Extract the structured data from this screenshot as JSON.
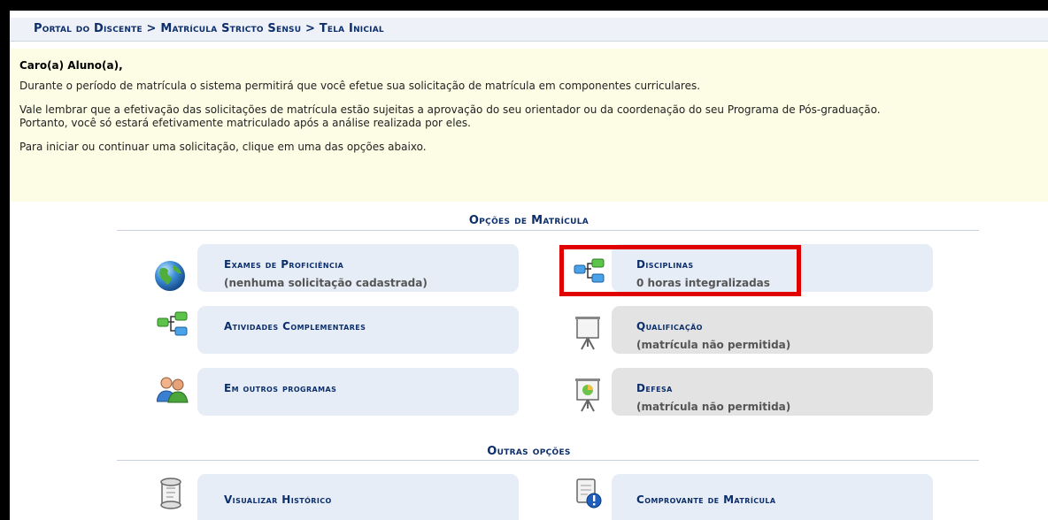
{
  "breadcrumb": "Portal do Discente > Matrícula Stricto Sensu > Tela Inicial",
  "notice": {
    "greeting": "Caro(a) Aluno(a),",
    "line1": "Durante o período de matrícula o sistema permitirá que você efetue sua solicitação de matrícula em componentes curriculares.",
    "line2a": "Vale lembrar que a efetivação das solicitações de matrícula estão sujeitas a aprovação do seu orientador ou da coordenação do seu Programa de Pós-graduação.",
    "line2b": "Portanto, você só estará efetivamente matriculado após a análise realizada por eles.",
    "line3": "Para iniciar ou continuar uma solicitação, clique em uma das opções abaixo."
  },
  "sections": {
    "opcoes": "Opções de Matrícula",
    "outras": "Outras opções"
  },
  "options": {
    "exames": {
      "title": "Exames de Proficiência",
      "sub": "(nenhuma solicitação cadastrada)",
      "icon": "globe-icon"
    },
    "disciplinas": {
      "title": "Disciplinas",
      "sub": "0 horas integralizadas",
      "icon": "tree-structure-icon"
    },
    "atividades": {
      "title": "Atividades Complementares",
      "icon": "tree-structure-icon"
    },
    "qualificacao": {
      "title": "Qualificação",
      "sub": "(matrícula não permitida)",
      "icon": "presentation-board-icon"
    },
    "outros": {
      "title": "Em outros programas",
      "icon": "users-icon"
    },
    "defesa": {
      "title": "Defesa",
      "sub": "(matrícula não permitida)",
      "icon": "presentation-chart-icon"
    }
  },
  "others": {
    "historico": {
      "title": "Visualizar Histórico",
      "icon": "scroll-icon"
    },
    "comprovante": {
      "title": "Comprovante de Matrícula",
      "icon": "document-alert-icon"
    }
  },
  "colors": {
    "accent": "#0c2f6b",
    "highlight": "#e10000",
    "notice_bg": "#fdfde5"
  }
}
